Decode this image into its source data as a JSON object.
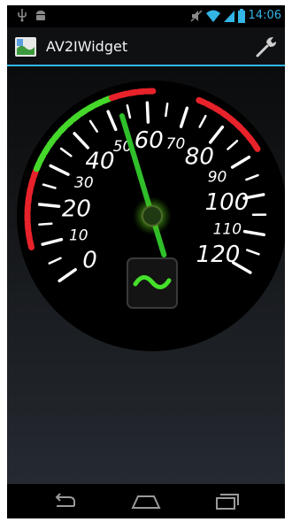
{
  "status_bar": {
    "time": "14:06",
    "left_icons": [
      "usb-icon",
      "android-debug-icon"
    ],
    "right_icons": [
      "mute-icon",
      "wifi-icon",
      "signal-icon",
      "battery-icon"
    ]
  },
  "action_bar": {
    "title": "AV2IWidget",
    "app_icon": "app-launcher-icon",
    "action_icon": "wrench-icon"
  },
  "gauge": {
    "labels": [
      "0",
      "10",
      "20",
      "30",
      "40",
      "50",
      "60",
      "70",
      "80",
      "90",
      "100",
      "110",
      "120"
    ],
    "min": 0,
    "max": 120,
    "reading": 53,
    "zone_colors": {
      "low": "#e8222a",
      "mid": "#45d82b",
      "high": "#e8222a"
    },
    "needle_color": "#2fbf2a",
    "mode_icon": "wave-icon"
  },
  "nav_bar": {
    "buttons": [
      "back-icon",
      "home-icon",
      "recents-icon"
    ]
  }
}
